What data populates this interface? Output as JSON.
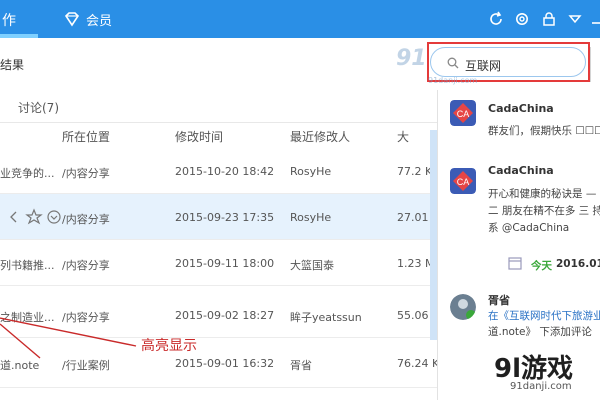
{
  "topbar": {
    "work_tab": "作",
    "vip_tab": "会员",
    "icons": [
      "refresh-icon",
      "settings-icon",
      "lock-icon",
      "minimize-icon",
      "close-icon"
    ]
  },
  "toolbar": {
    "results_label": "结果"
  },
  "search": {
    "value": "互联网"
  },
  "subtabs": {
    "discussion": "讨论(7)"
  },
  "table": {
    "columns": {
      "location": "所在位置",
      "modified_time": "修改时间",
      "modifier": "最近修改人",
      "size": "大"
    },
    "rows": [
      {
        "name": "业竞争的...",
        "location": "/内容分享",
        "time": "2015-10-20 18:42",
        "user": "RosyHe",
        "size": "77.2 KB"
      },
      {
        "name": "",
        "location": "/内容分享",
        "time": "2015-09-23 17:35",
        "user": "RosyHe",
        "size": "27.01 KB",
        "selected": true
      },
      {
        "name": "列书籍推...",
        "location": "/内容分享",
        "time": "2015-09-11 18:00",
        "user": "大篮国泰",
        "size": "1.23 MB"
      },
      {
        "name": "之制造业...",
        "location": "/内容分享",
        "time": "2015-09-02 18:27",
        "user": "眸子yeatssun",
        "size": "55.06 KB"
      },
      {
        "name": "道.note",
        "location": "/行业案例",
        "time": "2015-09-01 16:32",
        "user": "胥省",
        "size": "76.24 KB"
      }
    ]
  },
  "feed": {
    "items": [
      {
        "author": "CadaChina",
        "lines": [
          "群友们，假期快乐 ☐☐☐☐"
        ]
      },
      {
        "author": "CadaChina",
        "lines": [
          "开心和健康的秘诀是 — 不",
          "二 朋友在精不在多 三 持",
          "系 @CadaChina"
        ]
      },
      {
        "author": "胥省",
        "lines": [
          "在《互联网时代下旅游业",
          "道.note》 下添加评论"
        ]
      }
    ],
    "today_label": "今天",
    "date_label": "2016.01.0"
  },
  "annotation": {
    "label": "高亮显示"
  },
  "watermark": {
    "logo_text": "9l游戏",
    "url_text": "91danji.com",
    "search_logo": "91",
    "search_url": "91danji.com"
  },
  "colors": {
    "topbar": "#2a8fe6",
    "highlight": "#e43a3a",
    "selected_row": "#e6f2fd"
  }
}
